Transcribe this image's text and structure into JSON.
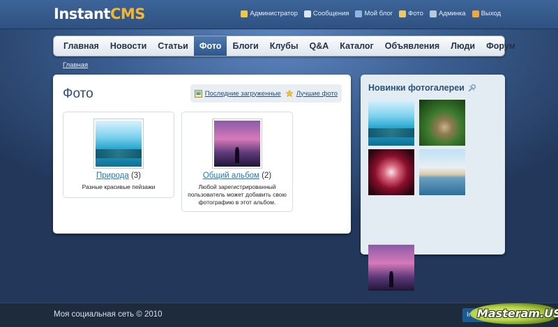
{
  "header": {
    "logo_part1": "Instant",
    "logo_part2": "CMS",
    "user_menu": [
      {
        "label": "Администратор",
        "icon": "user-icon",
        "color": "#f3c64a"
      },
      {
        "label": "Сообщения",
        "icon": "envelope-icon",
        "color": "#dbe6f2"
      },
      {
        "label": "Мой блог",
        "icon": "blog-icon",
        "color": "#8fb6e0"
      },
      {
        "label": "Фото",
        "icon": "photo-icon",
        "color": "#e9c86a"
      },
      {
        "label": "Админка",
        "icon": "admin-icon",
        "color": "#b9c9dc"
      },
      {
        "label": "Выход",
        "icon": "exit-icon",
        "color": "#f0a63a"
      }
    ]
  },
  "nav": {
    "items": [
      {
        "label": "Главная",
        "active": false
      },
      {
        "label": "Новости",
        "active": false
      },
      {
        "label": "Статьи",
        "active": false
      },
      {
        "label": "Фото",
        "active": true
      },
      {
        "label": "Блоги",
        "active": false
      },
      {
        "label": "Клубы",
        "active": false
      },
      {
        "label": "Q&A",
        "active": false
      },
      {
        "label": "Каталог",
        "active": false
      },
      {
        "label": "Объявления",
        "active": false
      },
      {
        "label": "Люди",
        "active": false
      },
      {
        "label": "Форум",
        "active": false
      }
    ]
  },
  "breadcrumb": "Главная",
  "main": {
    "title": "Фото",
    "links": [
      {
        "label": "Последние загруженные",
        "icon": "image-icon"
      },
      {
        "label": "Лучшие фото",
        "icon": "star-icon"
      }
    ],
    "albums": [
      {
        "name": "Природа",
        "count": "(3)",
        "description": "Разные красивые пейзажи",
        "image": "nature"
      },
      {
        "name": "Общий альбом",
        "count": "(2)",
        "description": "Любой зарегистрированный пользователь может добавить свою фотографию в этот альбом.",
        "image": "sunset"
      }
    ]
  },
  "sidebar": {
    "title": "Новинки фотогалереи",
    "title_icon": "settings-icon",
    "photos": [
      "nature",
      "garden",
      "flower",
      "beach",
      "sunset"
    ]
  },
  "footer": {
    "copyright": "Моя социальная сеть © 2010",
    "button_label": "Insta",
    "watermark": "Masteram.US"
  }
}
